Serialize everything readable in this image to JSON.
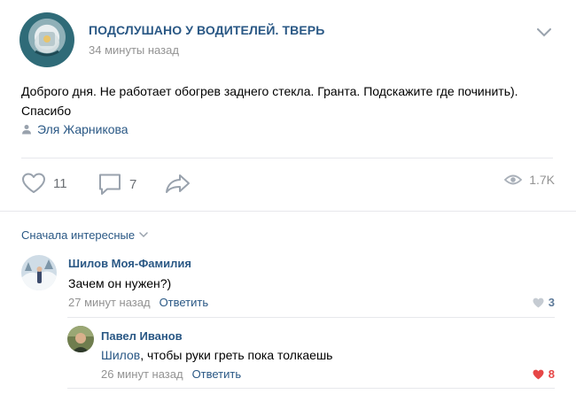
{
  "post": {
    "group_name": "ПОДСЛУШАНО У ВОДИТЕЛЕЙ. ТВЕРЬ",
    "time": "34 минуты назад",
    "text": "Доброго дня. Не работает обогрев заднего стекла. Гранта. Подскажите где починить). Спасибо",
    "author": "Эля Жарникова",
    "likes": "11",
    "comments": "7",
    "views": "1.7K"
  },
  "comments_section": {
    "sort_label": "Сначала интересные"
  },
  "comments": [
    {
      "name": "Шилов Моя-Фамилия",
      "text": "Зачем он нужен?)",
      "time": "27 минут назад",
      "reply_label": "Ответить",
      "likes": "3",
      "like_color": "#939393"
    },
    {
      "name": "Павел Иванов",
      "mention": "Шилов",
      "text": ", чтобы руки греть пока толкаешь",
      "time": "26 минут назад",
      "reply_label": "Ответить",
      "likes": "8",
      "like_color": "#e64646"
    }
  ],
  "colors": {
    "link": "#2a5885",
    "meta": "#939393",
    "liked": "#e64646"
  }
}
